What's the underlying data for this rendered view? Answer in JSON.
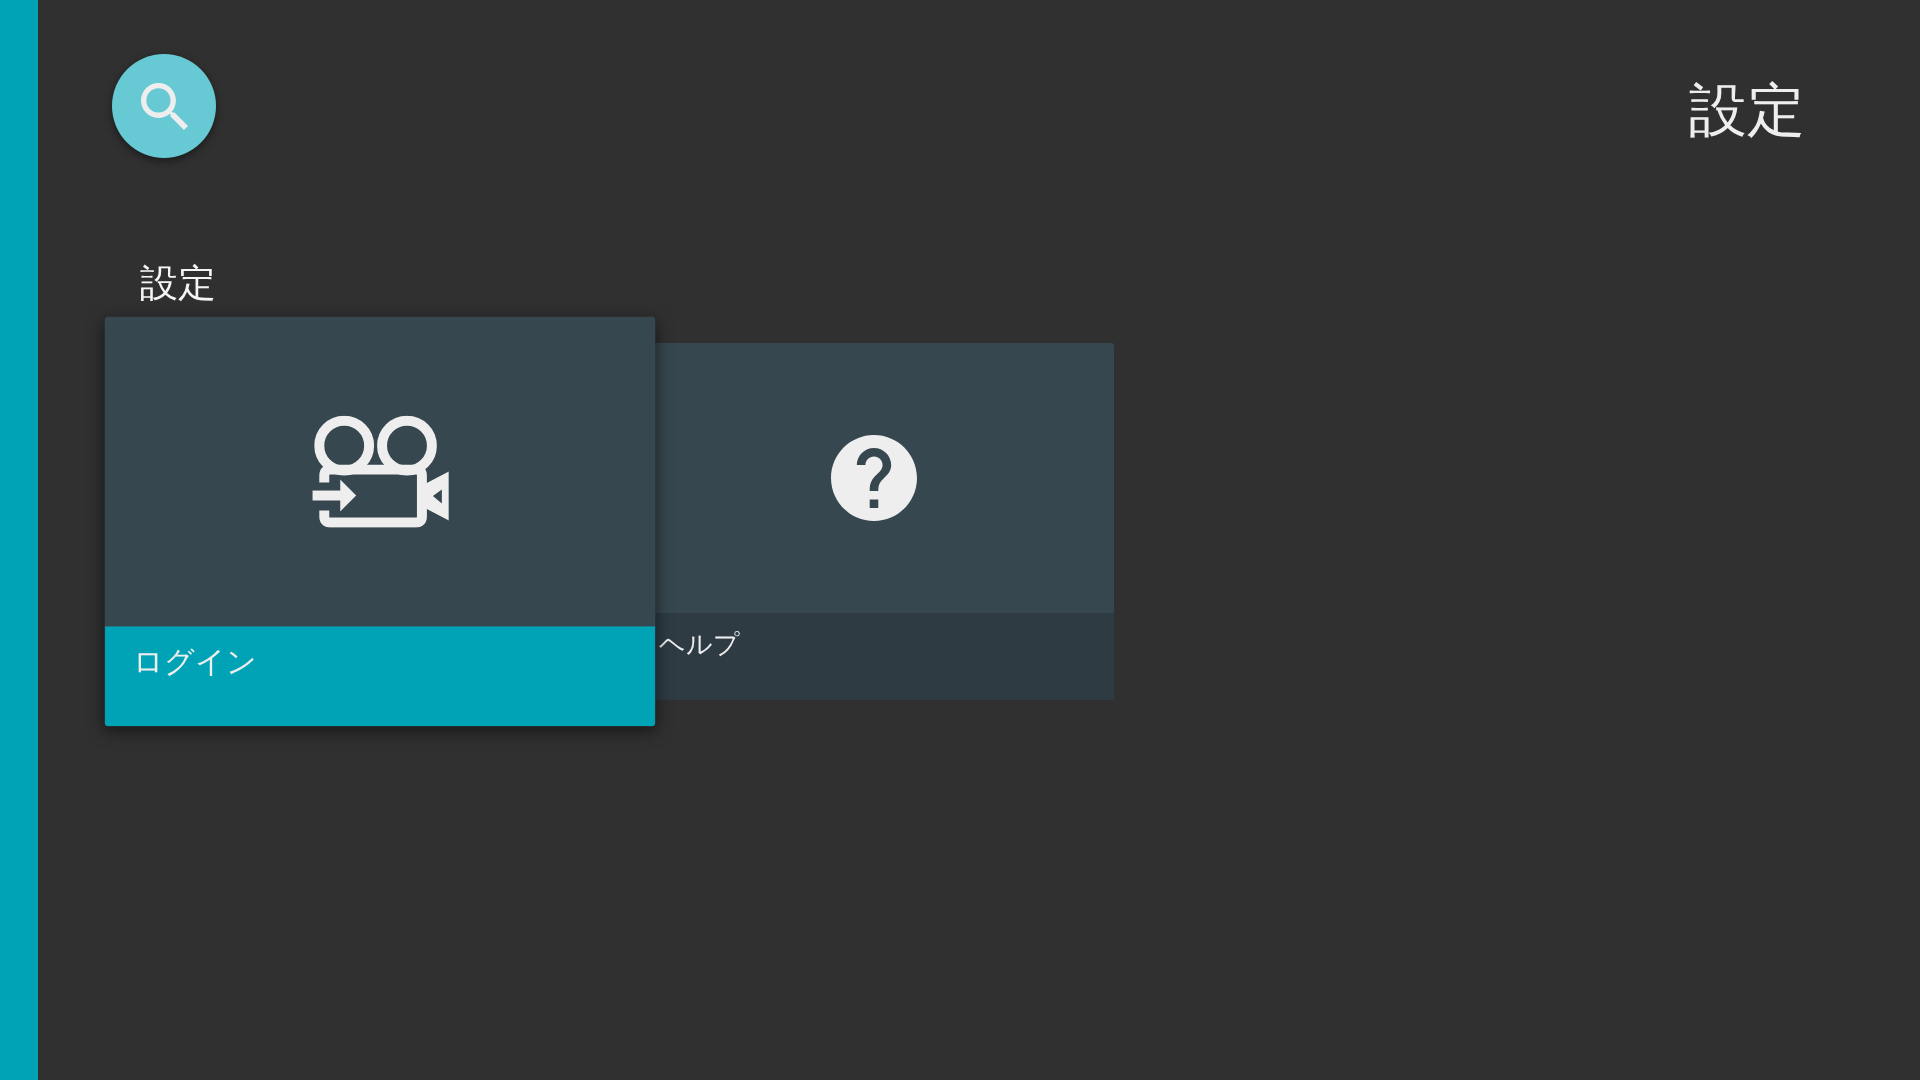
{
  "header": {
    "title": "設定"
  },
  "section": {
    "title": "設定",
    "cards": [
      {
        "kind": "login",
        "label": "ログイン",
        "selected": true
      },
      {
        "kind": "help",
        "label": "ヘルプ",
        "selected": false
      }
    ]
  }
}
